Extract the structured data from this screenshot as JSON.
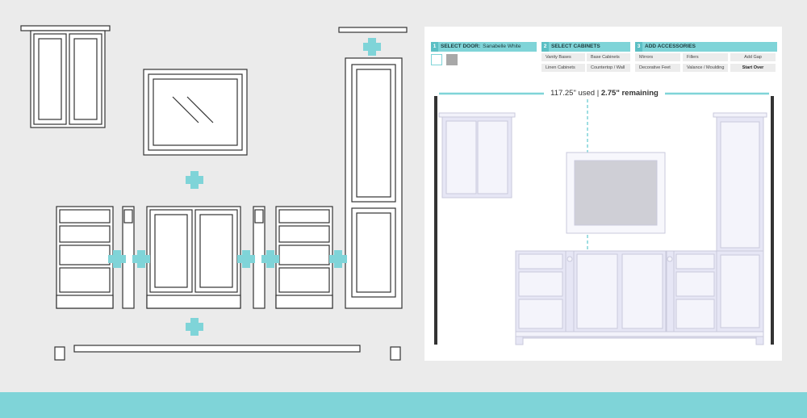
{
  "steps": [
    {
      "number": "1",
      "title": "SELECT DOOR:",
      "value": "Sanabelle White"
    },
    {
      "number": "2",
      "title": "SELECT CABINETS",
      "value": ""
    },
    {
      "number": "3",
      "title": "ADD ACCESSORIES",
      "value": ""
    }
  ],
  "door_swatches": [
    {
      "name": "Sanabelle White",
      "color": "#ffffff",
      "selected": true
    },
    {
      "name": "Gray",
      "color": "#a8a8a8",
      "selected": false
    }
  ],
  "cabinet_buttons": [
    "Vanity Bases",
    "Base Cabinets",
    "Linen Cabinets",
    "Countertop / Wall"
  ],
  "accessory_buttons": [
    "Mirrors",
    "Fillers",
    "Add Gap",
    "Decorative Feet",
    "Valance / Moulding",
    "Start Over"
  ],
  "usage": {
    "used": "117.25\" used",
    "separator": " | ",
    "remaining": "2.75\" remaining"
  },
  "colors": {
    "accent": "#7fd4d8",
    "accent_dark": "#5bbfc4",
    "background": "#ebebeb",
    "panel": "#ffffff",
    "cabinet_fill": "#e4e4f4",
    "wall": "#333333"
  }
}
